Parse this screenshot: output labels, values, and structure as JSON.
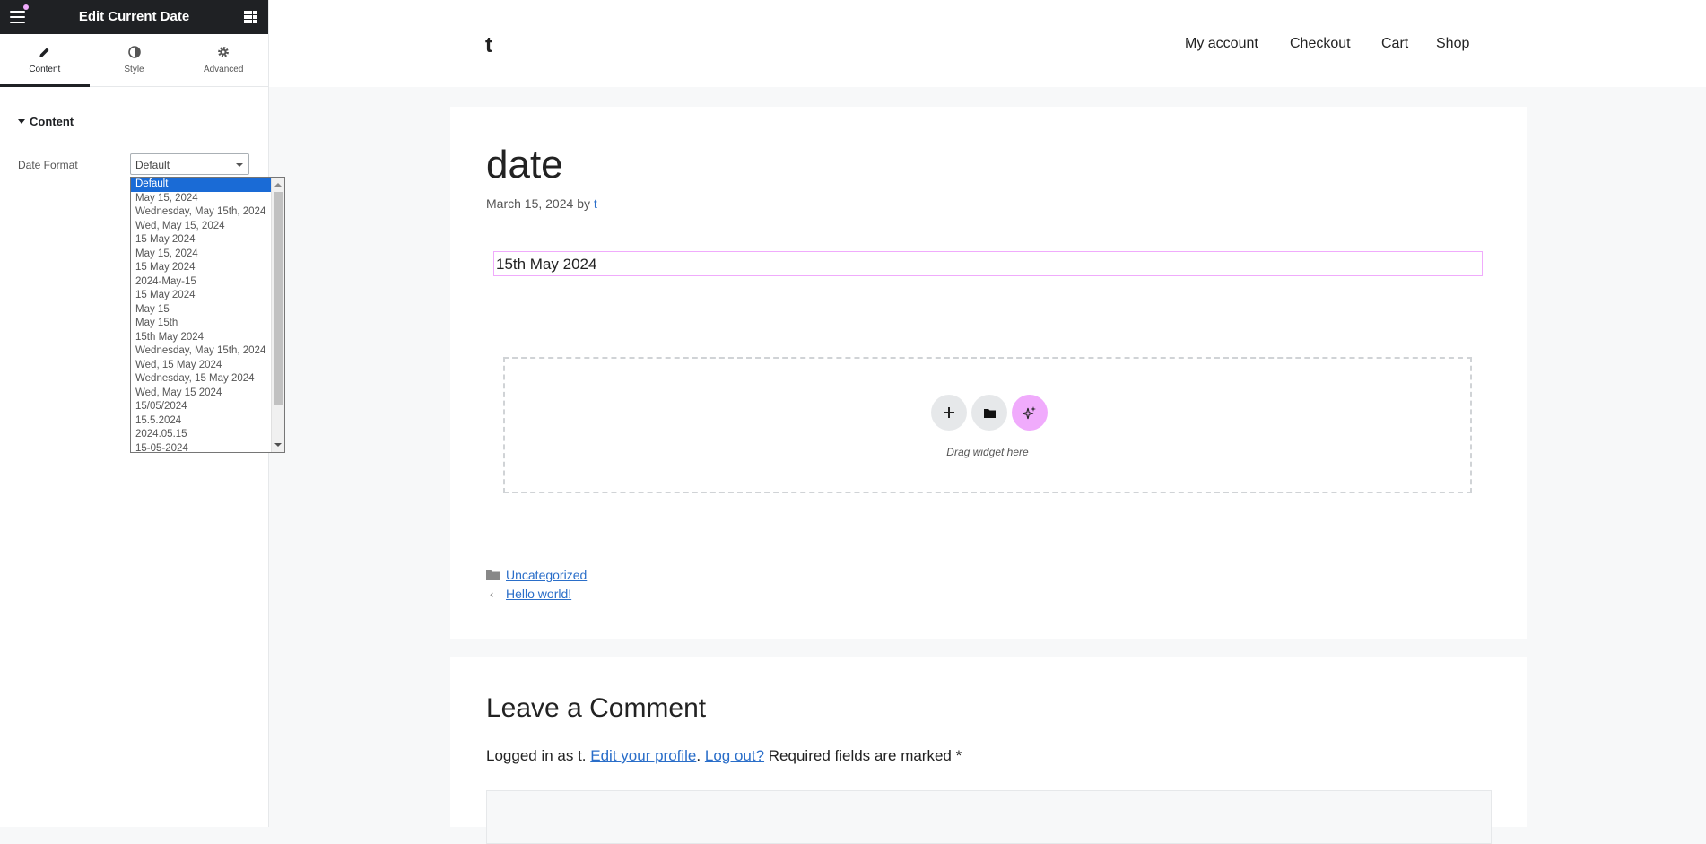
{
  "panel": {
    "title": "Edit Current Date",
    "tabs": [
      {
        "label": "Content",
        "icon": "pencil-icon"
      },
      {
        "label": "Style",
        "icon": "half-circle-icon"
      },
      {
        "label": "Advanced",
        "icon": "gear-icon"
      }
    ],
    "section_title": "Content",
    "date_format": {
      "label": "Date Format",
      "selected": "Default",
      "options": [
        "Default",
        "May 15, 2024",
        "Wednesday, May 15th, 2024",
        "Wed, May 15, 2024",
        "15 May 2024",
        "May 15, 2024",
        "15 May 2024",
        "2024-May-15",
        "15 May 2024",
        "May 15",
        "May 15th",
        "15th May 2024",
        "Wednesday, May 15th, 2024",
        "Wed, 15 May 2024",
        "Wednesday, 15 May 2024",
        "Wed, May 15 2024",
        "15/05/2024",
        "15.5.2024",
        "2024.05.15",
        "15-05-2024"
      ]
    }
  },
  "site": {
    "logo": "t",
    "nav": [
      "My account",
      "Checkout",
      "Cart",
      "Shop"
    ]
  },
  "post": {
    "title": "date",
    "meta_date": "March 15, 2024",
    "meta_by": "by",
    "meta_author": "t",
    "date_widget_value": "15th May 2024",
    "drop_zone_text": "Drag widget here",
    "category": "Uncategorized",
    "prev_post": "Hello world!"
  },
  "comments": {
    "title": "Leave a Comment",
    "logged_prefix": "Logged in as t.",
    "edit_profile": "Edit your profile",
    "log_out": "Log out?",
    "required": "Required fields are marked *"
  },
  "colors": {
    "accent_pink": "#f0abfc",
    "link_blue": "#2a6ec9",
    "panel_dark": "#1f2124",
    "dropdown_selected": "#1a6bd6"
  }
}
